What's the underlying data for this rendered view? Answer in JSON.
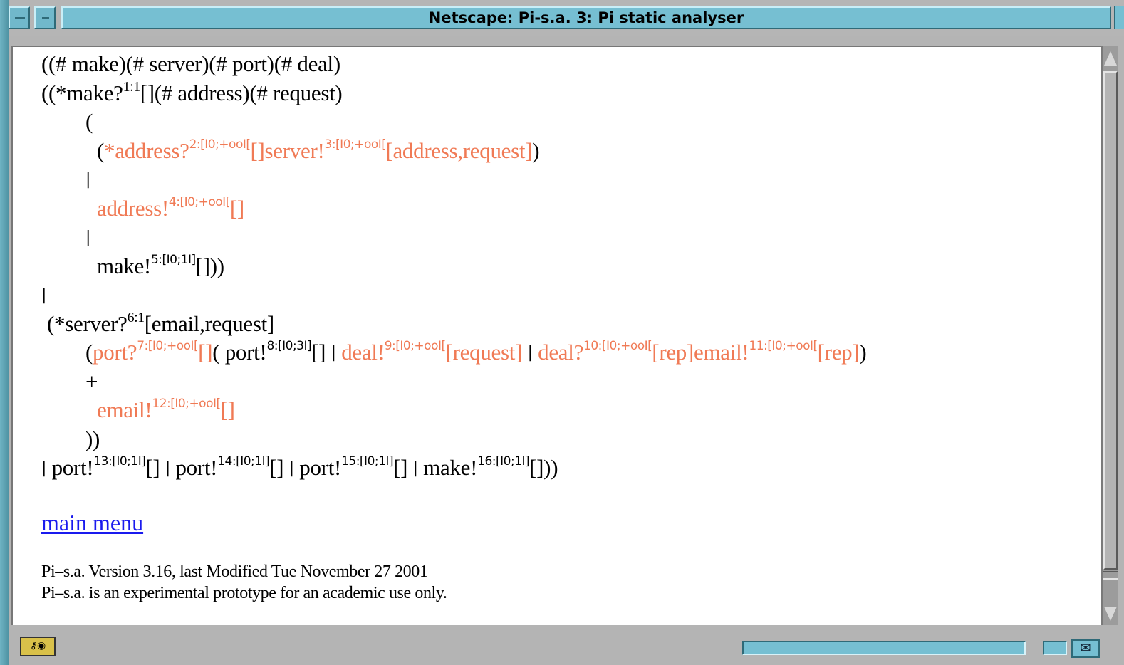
{
  "window": {
    "title": "Netscape: Pi-s.a. 3: Pi static analyser"
  },
  "colors": {
    "highlight": "#f07a55",
    "link": "#1a1aee",
    "frame": "#76bfd2"
  },
  "code": {
    "l1": "((# make)(# server)(# port)(# deal)",
    "l2a": "((*make?",
    "l2s": "1:1",
    "l2b": "[](# address)(# request)",
    "l3": "(",
    "l4a": "(",
    "l4b": "*address?",
    "l4s1": "2:[I0;+ooI[",
    "l4c": "[]server!",
    "l4s2": "3:[I0;+ooI[",
    "l4d": "[address,request]",
    "l4e": ")",
    "bar": "|",
    "l6a": "address!",
    "l6s": "4:[I0;+ooI[",
    "l6b": "[]",
    "l8a": "make!",
    "l8s": "5:[I0;1I]",
    "l8b": "[]))",
    "l10a": "(*server?",
    "l10s": "6:1",
    "l10b": "[email,request]",
    "l11a": "(",
    "l11b": "port?",
    "l11s1": "7:[I0;+ooI[",
    "l11c": "[]",
    "l11d": "( port!",
    "l11s2": "8:[I0;3I]",
    "l11e": "[]",
    "l11f": "deal!",
    "l11s3": "9:[I0;+ooI[",
    "l11g": "[request]",
    "l11h": "deal?",
    "l11s4": "10:[I0;+ooI[",
    "l11i": "[rep]email!",
    "l11s5": "11:[I0;+ooI[",
    "l11j": "[rep]",
    "l11k": ")",
    "plus": "+",
    "l13a": "email!",
    "l13s": "12:[I0;+ooI[",
    "l13b": "[]",
    "l14": "))",
    "l15a": "port!",
    "l15s1": "13:[I0;1I]",
    "l15b": "[]",
    "l15c": "port!",
    "l15s2": "14:[I0;1I]",
    "l15d": "[]",
    "l15e": "port!",
    "l15s3": "15:[I0;1I]",
    "l15f": "[]",
    "l15g": "make!",
    "l15s4": "16:[I0;1I]",
    "l15h": "[]))"
  },
  "links": {
    "main_menu": "main menu"
  },
  "footer": {
    "line1": "Pi–s.a. Version 3.16, last Modified Tue November 27 2001",
    "line2": "Pi–s.a. is an experimental prototype for an academic use only."
  },
  "status": {
    "security_icon": "lock-key-icon",
    "mail_icon": "mail-envelope-icon"
  }
}
